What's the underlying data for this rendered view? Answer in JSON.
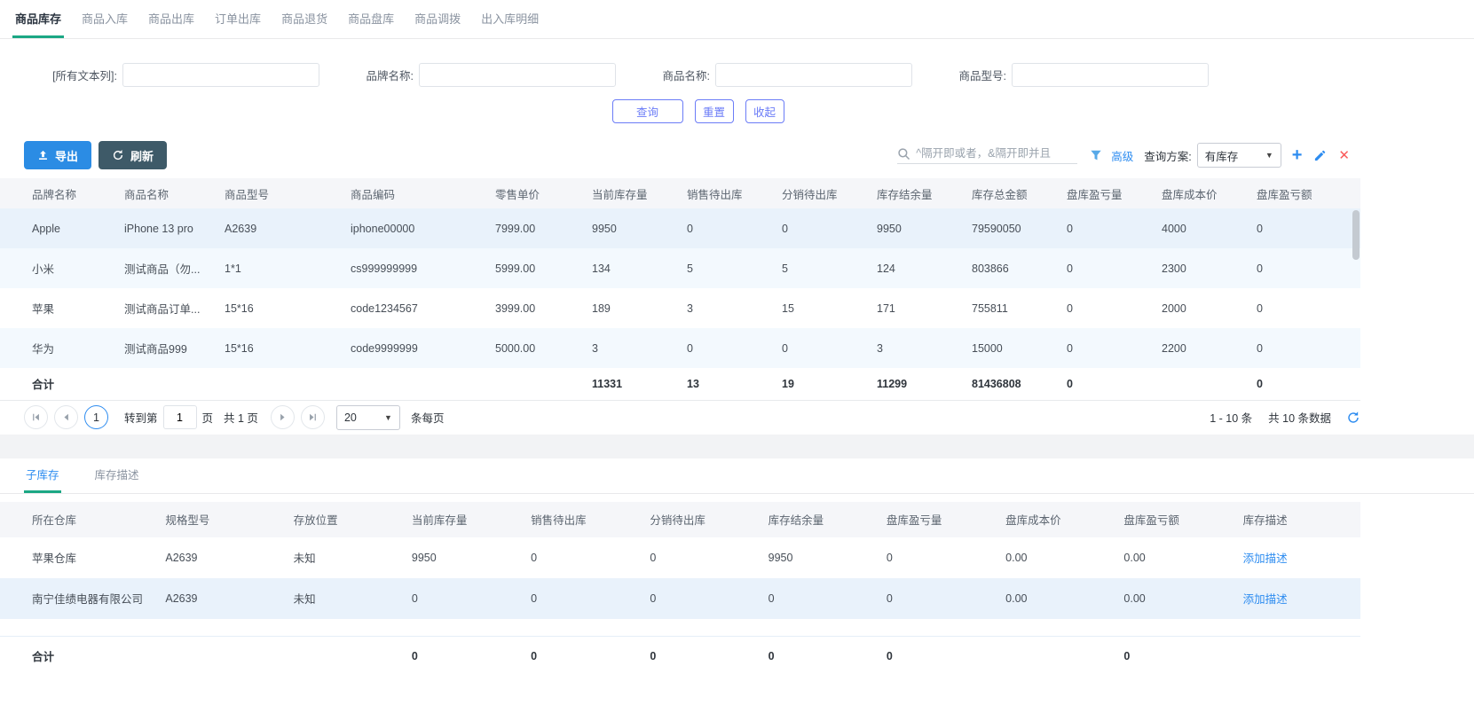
{
  "top_tabs": [
    "商品库存",
    "商品入库",
    "商品出库",
    "订单出库",
    "商品退货",
    "商品盘库",
    "商品调拨",
    "出入库明细"
  ],
  "filters": {
    "all_text_label": "[所有文本列]:",
    "brand_label": "品牌名称:",
    "product_label": "商品名称:",
    "model_label": "商品型号:",
    "query": "查询",
    "reset": "重置",
    "collapse": "收起"
  },
  "toolbar": {
    "export": "导出",
    "refresh": "刷新",
    "search_placeholder": "^隔开即或者，&隔开即并且",
    "advanced": "高级",
    "scheme_label": "查询方案:",
    "scheme_value": "有库存"
  },
  "main_table": {
    "columns": [
      "品牌名称",
      "商品名称",
      "商品型号",
      "商品编码",
      "零售单价",
      "当前库存量",
      "销售待出库",
      "分销待出库",
      "库存结余量",
      "库存总金额",
      "盘库盈亏量",
      "盘库成本价",
      "盘库盈亏额"
    ],
    "rows": [
      [
        "Apple",
        "iPhone 13 pro",
        "A2639",
        "iphone00000",
        "7999.00",
        "9950",
        "0",
        "0",
        "9950",
        "79590050",
        "0",
        "4000",
        "0"
      ],
      [
        "小米",
        "测试商品（勿...",
        "1*1",
        "cs999999999",
        "5999.00",
        "134",
        "5",
        "5",
        "124",
        "803866",
        "0",
        "2300",
        "0"
      ],
      [
        "苹果",
        "测试商品订单...",
        "15*16",
        "code1234567",
        "3999.00",
        "189",
        "3",
        "15",
        "171",
        "755811",
        "0",
        "2000",
        "0"
      ],
      [
        "华为",
        "测试商品999",
        "15*16",
        "code9999999",
        "5000.00",
        "3",
        "0",
        "0",
        "3",
        "15000",
        "0",
        "2200",
        "0"
      ]
    ],
    "totals": [
      "合计",
      "",
      "",
      "",
      "",
      "11331",
      "13",
      "19",
      "11299",
      "81436808",
      "0",
      "",
      "0"
    ]
  },
  "pagination": {
    "current_page": "1",
    "goto_label": "转到第",
    "page_input": "1",
    "page_unit": "页",
    "total_pages": "共 1 页",
    "page_size": "20",
    "per_page": "条每页",
    "range": "1 - 10 条",
    "total": "共 10 条数据"
  },
  "sub_tabs": [
    "子库存",
    "库存描述"
  ],
  "sub_table": {
    "columns": [
      "所在仓库",
      "规格型号",
      "存放位置",
      "当前库存量",
      "销售待出库",
      "分销待出库",
      "库存结余量",
      "盘库盈亏量",
      "盘库成本价",
      "盘库盈亏额",
      "库存描述"
    ],
    "rows": [
      [
        "苹果仓库",
        "A2639",
        "未知",
        "9950",
        "0",
        "0",
        "9950",
        "0",
        "0.00",
        "0.00"
      ],
      [
        "南宁佳绩电器有限公司",
        "A2639",
        "未知",
        "0",
        "0",
        "0",
        "0",
        "0",
        "0.00",
        "0.00"
      ]
    ],
    "add_desc_label": "添加描述",
    "totals": [
      "合计",
      "",
      "",
      "0",
      "0",
      "0",
      "0",
      "0",
      "",
      "0",
      ""
    ]
  },
  "colors": {
    "accent_blue": "#2d8cf0",
    "teal_underline": "#1ba784",
    "export_button": "#2b8ce4",
    "refresh_button": "#3e5a68",
    "outline_button": "#6b7cf7",
    "danger_red": "#fa5a5a",
    "selected_row": "#e9f2fb"
  }
}
